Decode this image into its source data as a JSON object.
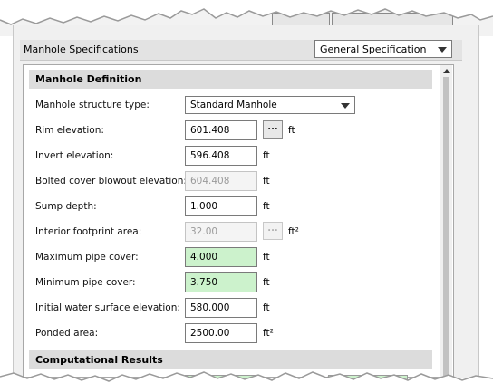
{
  "spec": {
    "title": "Manhole Specifications",
    "dropdown_value": "General Specification"
  },
  "sections": {
    "definition": "Manhole Definition",
    "results": "Computational Results"
  },
  "fields": {
    "structure_type": {
      "label": "Manhole structure type:",
      "value": "Standard Manhole"
    },
    "rim": {
      "label": "Rim elevation:",
      "value": "601.408",
      "unit": "ft",
      "button": "..."
    },
    "invert": {
      "label": "Invert elevation:",
      "value": "596.408",
      "unit": "ft"
    },
    "bolted": {
      "label": "Bolted cover blowout elevation:",
      "value": "604.408",
      "unit": "ft"
    },
    "sump": {
      "label": "Sump depth:",
      "value": "1.000",
      "unit": "ft"
    },
    "footprint": {
      "label": "Interior footprint area:",
      "value": "32.00",
      "unit": "ft²",
      "button": "..."
    },
    "max_cover": {
      "label": "Maximum pipe cover:",
      "value": "4.000",
      "unit": "ft"
    },
    "min_cover": {
      "label": "Minimum pipe cover:",
      "value": "3.750",
      "unit": "ft"
    },
    "initial_ws": {
      "label": "Initial water surface elevation:",
      "value": "580.000",
      "unit": "ft"
    },
    "ponded": {
      "label": "Ponded area:",
      "value": "2500.00",
      "unit": "ft²"
    }
  },
  "colors": {
    "computed_field": "#ccf2cc",
    "section_header": "#dcdcdc"
  }
}
